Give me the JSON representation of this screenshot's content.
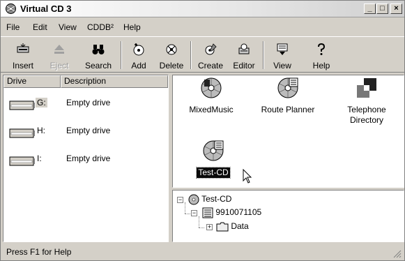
{
  "window": {
    "title": "Virtual CD 3"
  },
  "titlebar_buttons": {
    "minimize": "_",
    "maximize": "□",
    "close": "×"
  },
  "menu": [
    "File",
    "Edit",
    "View",
    "CDDB²",
    "Help"
  ],
  "toolbar": [
    {
      "label": "Insert",
      "icon": "insert-icon",
      "enabled": true
    },
    {
      "label": "Eject",
      "icon": "eject-icon",
      "enabled": false
    },
    {
      "label": "Search",
      "icon": "binoculars-icon",
      "enabled": true
    },
    {
      "label": "Add",
      "icon": "add-cd-icon",
      "enabled": true
    },
    {
      "label": "Delete",
      "icon": "delete-cd-icon",
      "enabled": true
    },
    {
      "label": "Create",
      "icon": "create-icon",
      "enabled": true
    },
    {
      "label": "Editor",
      "icon": "editor-icon",
      "enabled": true
    },
    {
      "label": "View",
      "icon": "view-icon",
      "enabled": true
    },
    {
      "label": "Help",
      "icon": "help-icon",
      "enabled": true
    }
  ],
  "drive_list": {
    "columns": [
      "Drive",
      "Description"
    ],
    "rows": [
      {
        "drive": "G:",
        "description": "Empty drive"
      },
      {
        "drive": "H:",
        "description": "Empty drive"
      },
      {
        "drive": "I:",
        "description": "Empty drive"
      }
    ]
  },
  "cd_items": [
    {
      "label": "MixedMusic",
      "icon": "cd-music-icon",
      "selected": false
    },
    {
      "label": "Route Planner",
      "icon": "cd-data-icon",
      "selected": false
    },
    {
      "label": "Telephone\nDirectory",
      "icon": "directory-icon",
      "selected": false
    },
    {
      "label": "Test-CD",
      "icon": "cd-data-icon",
      "selected": true
    }
  ],
  "tree": {
    "root": "Test-CD",
    "child": "9910071105",
    "grandchild": "Data"
  },
  "status": {
    "text": "Press F1 for Help"
  }
}
